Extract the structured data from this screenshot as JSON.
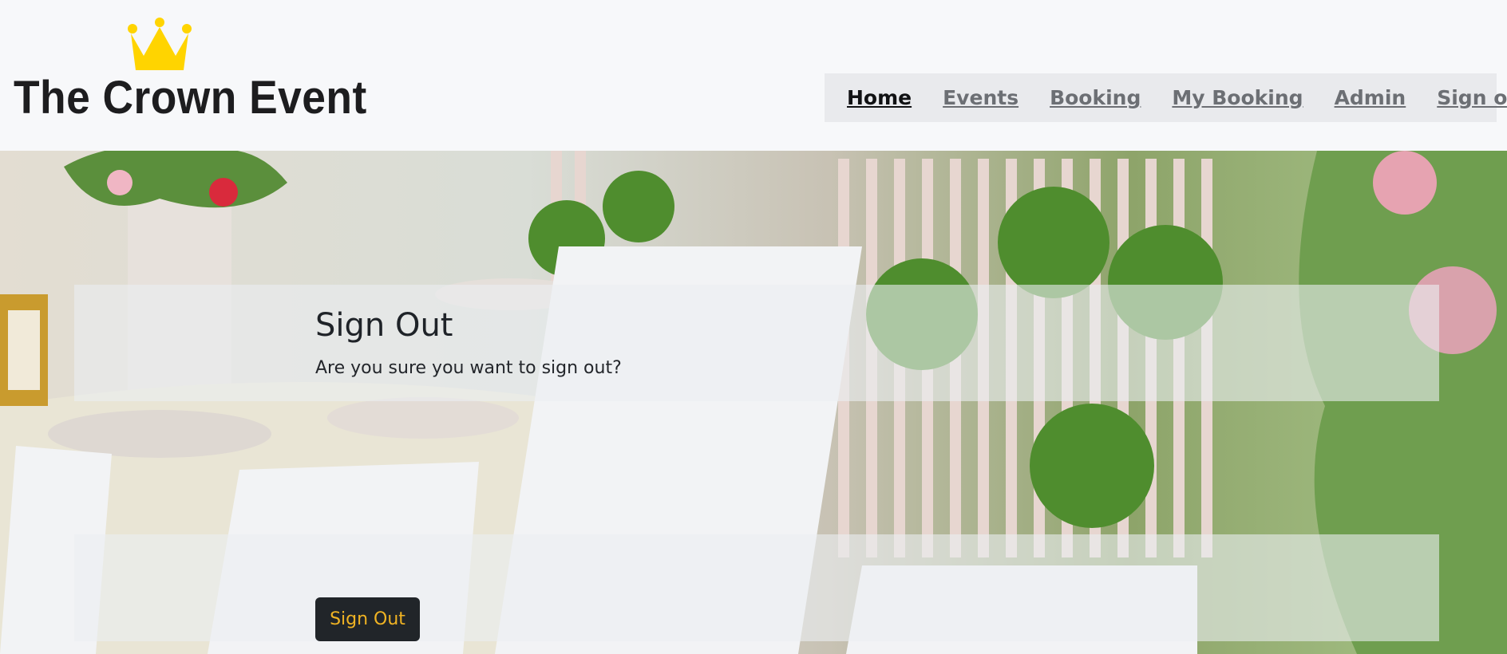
{
  "brand": {
    "name": "The Crown Event",
    "logo_icon": "crown-icon",
    "logo_color": "#ffd400"
  },
  "nav": {
    "items": [
      {
        "label": "Home",
        "active": true
      },
      {
        "label": "Events",
        "active": false
      },
      {
        "label": "Booking",
        "active": false
      },
      {
        "label": "My Booking",
        "active": false
      },
      {
        "label": "Admin",
        "active": false
      },
      {
        "label": "Sign out",
        "active": false
      }
    ]
  },
  "main": {
    "title": "Sign Out",
    "message": "Are you sure you want to sign out?",
    "button_label": "Sign Out",
    "button_bg": "#212529",
    "button_text_color": "#f0b323"
  }
}
